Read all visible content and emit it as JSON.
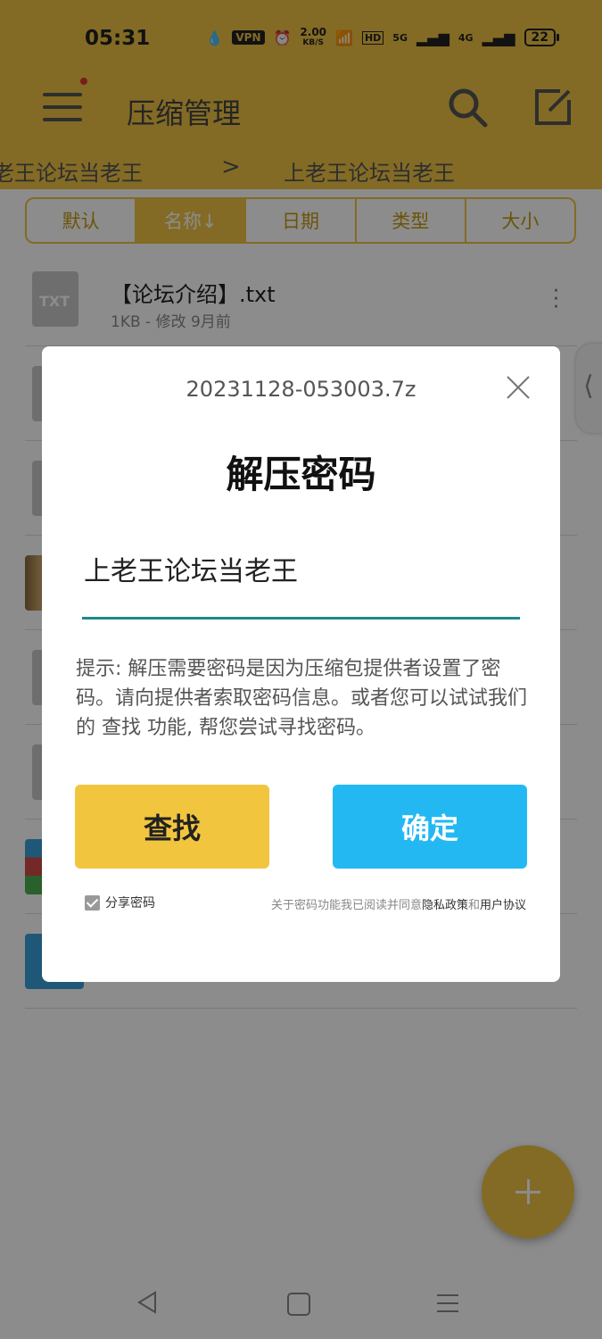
{
  "status_bar": {
    "time": "05:31",
    "vpn": "VPN",
    "net_speed_value": "2.00",
    "net_speed_unit": "KB/S",
    "hd": "HD",
    "signal_1": "5G",
    "signal_2": "4G",
    "battery": "22"
  },
  "header": {
    "title": "压缩管理",
    "icons": [
      "menu-icon",
      "search-icon",
      "edit-icon"
    ]
  },
  "breadcrumb": {
    "items": [
      "老王论坛当老王",
      "上老王论坛当老王"
    ],
    "separator": ">"
  },
  "sort_tabs": [
    {
      "label": "默认"
    },
    {
      "label": "名称↓",
      "active": true
    },
    {
      "label": "日期"
    },
    {
      "label": "类型"
    },
    {
      "label": "大小"
    }
  ],
  "files": [
    {
      "name": "【论坛介绍】.txt",
      "meta": "1KB - 修改 9月前"
    }
  ],
  "dialog": {
    "filename": "20231128-053003.7z",
    "title": "解压密码",
    "password_value": "上老王论坛当老王",
    "hint": "提示: 解压需要密码是因为压缩包提供者设置了密码。请向提供者索取密码信息。或者您可以试试我们的 查找 功能, 帮您尝试寻找密码。",
    "find_button": "查找",
    "confirm_button": "确定",
    "share_label": "分享密码",
    "share_checked": true,
    "agree_prefix": "关于密码功能我已阅读并同意",
    "privacy_link": "隐私政策",
    "agree_and": "和",
    "terms_link": "用户协议"
  },
  "colors": {
    "header": "#efc444",
    "find_button": "#f2c53f",
    "confirm_button": "#23b8f2",
    "input_underline": "#1d8a8a"
  }
}
